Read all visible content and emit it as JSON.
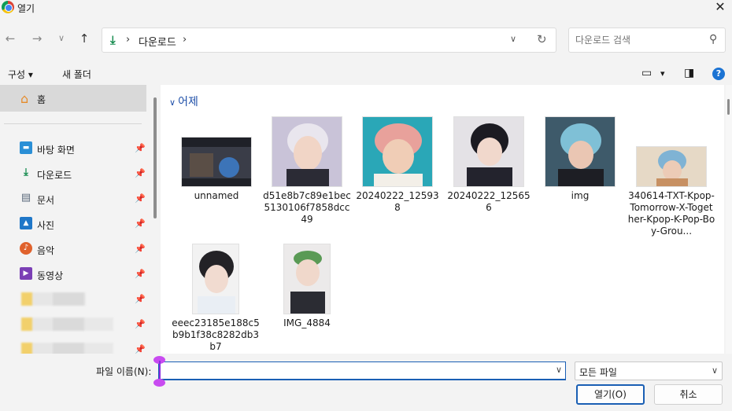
{
  "window": {
    "title": "열기",
    "close": "✕"
  },
  "nav": {
    "back": "←",
    "forward": "→",
    "recent": "∨",
    "up": "↑"
  },
  "address": {
    "crumb_sep": "›",
    "location": "다운로드",
    "trailing_sep": "›"
  },
  "search": {
    "placeholder": "다운로드 검색"
  },
  "toolbar": {
    "organize": "구성 ▾",
    "new_folder": "새 폴더",
    "view_dd": "▾",
    "help": "?"
  },
  "sidebar": {
    "home": "홈",
    "items": [
      {
        "label": "바탕 화면",
        "icon": "desktop-icon"
      },
      {
        "label": "다운로드",
        "icon": "download-icon"
      },
      {
        "label": "문서",
        "icon": "document-icon"
      },
      {
        "label": "사진",
        "icon": "pictures-icon"
      },
      {
        "label": "음악",
        "icon": "music-icon"
      },
      {
        "label": "동영상",
        "icon": "videos-icon"
      }
    ]
  },
  "content": {
    "group": "어제",
    "files": [
      {
        "name": "unnamed"
      },
      {
        "name": "d51e8b7c89e1bec5130106f7858dcc49"
      },
      {
        "name": "20240222_125938"
      },
      {
        "name": "20240222_125656"
      },
      {
        "name": "img"
      },
      {
        "name": "340614-TXT-Kpop-Tomorrow-X-Together-Kpop-K-Pop-Boy-Grou..."
      },
      {
        "name": "eeec23185e188c5b9b1f38c8282db3b7"
      },
      {
        "name": "IMG_4884"
      }
    ]
  },
  "bottom": {
    "filename_label": "파일 이름(N):",
    "filename_value": "",
    "filetype": "모든 파일",
    "open": "열기(O)",
    "cancel": "취소"
  }
}
